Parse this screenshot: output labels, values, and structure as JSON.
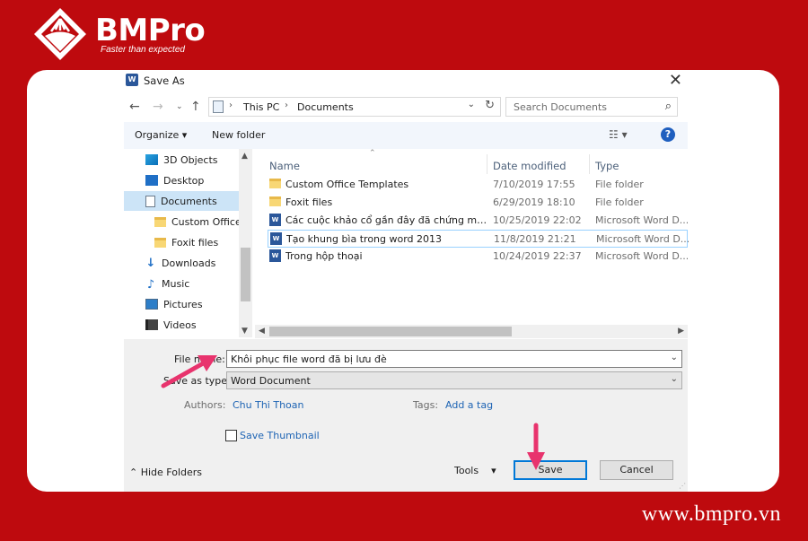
{
  "brand": {
    "name": "BMPro",
    "tagline": "Faster than expected",
    "url": "www.bmpro.vn"
  },
  "dialog": {
    "title": "Save As",
    "close_glyph": "✕",
    "breadcrumb": [
      "This PC",
      "Documents"
    ],
    "search_placeholder": "Search Documents",
    "organize_label": "Organize",
    "new_folder_label": "New folder",
    "nav_pane": [
      {
        "label": "3D Objects",
        "icon": "3d-objects-icon",
        "indent": 1
      },
      {
        "label": "Desktop",
        "icon": "desktop-icon",
        "indent": 1
      },
      {
        "label": "Documents",
        "icon": "documents-icon",
        "indent": 1,
        "selected": true
      },
      {
        "label": "Custom Office",
        "icon": "folder-icon",
        "indent": 2
      },
      {
        "label": "Foxit files",
        "icon": "folder-icon",
        "indent": 2
      },
      {
        "label": "Downloads",
        "icon": "downloads-icon",
        "indent": 1
      },
      {
        "label": "Music",
        "icon": "music-icon",
        "indent": 1
      },
      {
        "label": "Pictures",
        "icon": "pictures-icon",
        "indent": 1
      },
      {
        "label": "Videos",
        "icon": "videos-icon",
        "indent": 1
      }
    ],
    "columns": {
      "name": "Name",
      "date": "Date modified",
      "type": "Type"
    },
    "files": [
      {
        "name": "Custom Office Templates",
        "date": "7/10/2019 17:55",
        "type": "File folder",
        "kind": "folder"
      },
      {
        "name": "Foxit files",
        "date": "6/29/2019 18:10",
        "type": "File folder",
        "kind": "folder"
      },
      {
        "name": "Các cuộc khảo cổ gần đây đã chứng min...",
        "date": "10/25/2019 22:02",
        "type": "Microsoft Word D...",
        "kind": "word"
      },
      {
        "name": "Tạo khung bìa trong word 2013",
        "date": "11/8/2019 21:21",
        "type": "Microsoft Word D...",
        "kind": "word",
        "selected": true
      },
      {
        "name": "Trong hộp thoại",
        "date": "10/24/2019 22:37",
        "type": "Microsoft Word D...",
        "kind": "word"
      }
    ],
    "file_name_label": "File name:",
    "file_name_value": "Khôi phục file word đã bị lưu đè",
    "save_as_type_label": "Save as type:",
    "save_as_type_value": "Word Document",
    "authors_label": "Authors:",
    "authors_value": "Chu Thi Thoan",
    "tags_label": "Tags:",
    "tags_value": "Add a tag",
    "save_thumbnail_label": "Save Thumbnail",
    "hide_folders_label": "Hide Folders",
    "tools_label": "Tools",
    "save_label": "Save",
    "cancel_label": "Cancel"
  },
  "colors": {
    "background": "#be0a0e",
    "accent": "#0078d7",
    "annotation_arrow": "#e8336d"
  }
}
